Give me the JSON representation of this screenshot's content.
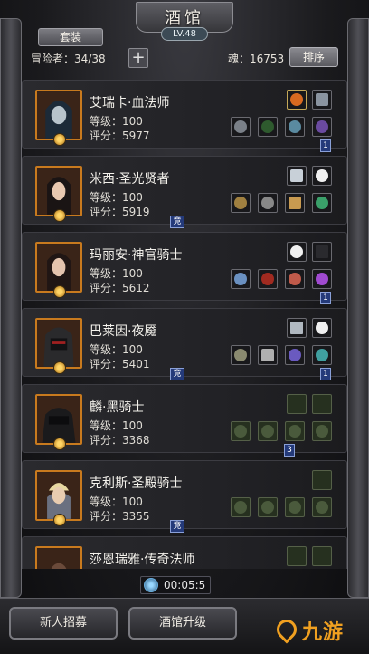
{
  "window": {
    "title": "酒馆",
    "level": "LV.48"
  },
  "tabs": {
    "outfit": "套装"
  },
  "topbar": {
    "adventurer_label": "冒险者：34/38",
    "add_symbol": "+",
    "soul_label": "魂：16753",
    "sort_label": "排序"
  },
  "heroes": [
    {
      "name": "艾瑞卡·血法师",
      "level": "等级：100",
      "score": "评分：5977"
    },
    {
      "name": "米西·圣光贤者",
      "level": "等级：100",
      "score": "评分：5919"
    },
    {
      "name": "玛丽安·神官骑士",
      "level": "等级：100",
      "score": "评分：5612"
    },
    {
      "name": "巴莱因·夜魇",
      "level": "等级：100",
      "score": "评分：5401"
    },
    {
      "name": "麟·黑骑士",
      "level": "等级：100",
      "score": "评分：3368"
    },
    {
      "name": "克利斯·圣殿骑士",
      "level": "等级：100",
      "score": "评分：3355"
    },
    {
      "name": "莎恩瑞雅·传奇法师",
      "level": "",
      "score": ""
    }
  ],
  "tags": {
    "side_1": "1",
    "side_3": "3",
    "compete": "竞"
  },
  "timer": "00:05:5",
  "bottom": {
    "recruit_label": "新人招募",
    "upgrade_label": "酒馆升级",
    "watermark": "九游"
  },
  "colors": {
    "portrait_border": "#c87a1e",
    "tag_blue": "#243a7a",
    "watermark": "#f0a020"
  }
}
